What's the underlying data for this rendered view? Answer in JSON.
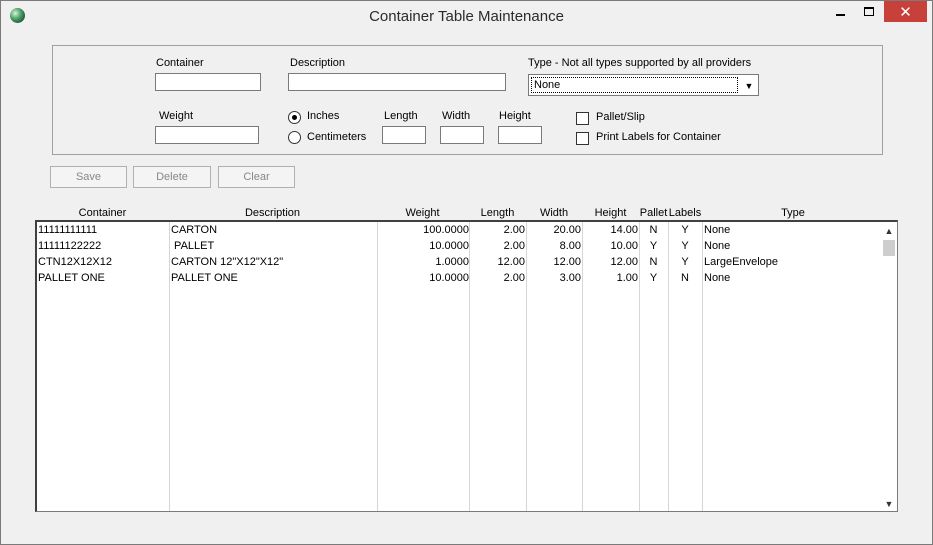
{
  "window": {
    "title": "Container Table Maintenance",
    "close_glyph": "✕"
  },
  "form": {
    "container_label": "Container",
    "container_value": "",
    "description_label": "Description",
    "description_value": "",
    "type_label": "Type - Not all types supported by all providers",
    "type_selected": "None",
    "weight_label": "Weight",
    "weight_value": "",
    "unit_inches": "Inches",
    "unit_centimeters": "Centimeters",
    "unit_selected": "Inches",
    "length_label": "Length",
    "width_label": "Width",
    "height_label": "Height",
    "length_value": "",
    "width_value": "",
    "height_value": "",
    "pallet_slip_label": "Pallet/Slip",
    "pallet_slip_checked": false,
    "print_labels_label": "Print Labels for Container",
    "print_labels_checked": false
  },
  "buttons": {
    "save": "Save",
    "delete": "Delete",
    "clear": "Clear"
  },
  "table": {
    "columns": [
      "Container",
      "Description",
      "Weight",
      "Length",
      "Width",
      "Height",
      "Pallet",
      "Labels",
      "Type"
    ],
    "rows": [
      {
        "container": "11111111111",
        "description": "CARTON",
        "weight": "100.0000",
        "length": "2.00",
        "width": "20.00",
        "height": "14.00",
        "pallet": "N",
        "labels": "Y",
        "type": "None"
      },
      {
        "container": "11111122222",
        "description": " PALLET",
        "weight": "10.0000",
        "length": "2.00",
        "width": "8.00",
        "height": "10.00",
        "pallet": "Y",
        "labels": "Y",
        "type": "None"
      },
      {
        "container": "CTN12X12X12",
        "description": "CARTON 12\"X12\"X12\"",
        "weight": "1.0000",
        "length": "12.00",
        "width": "12.00",
        "height": "12.00",
        "pallet": "N",
        "labels": "Y",
        "type": "LargeEnvelope"
      },
      {
        "container": "PALLET ONE",
        "description": "PALLET ONE",
        "weight": "10.0000",
        "length": "2.00",
        "width": "3.00",
        "height": "1.00",
        "pallet": "Y",
        "labels": "N",
        "type": "None"
      }
    ]
  }
}
